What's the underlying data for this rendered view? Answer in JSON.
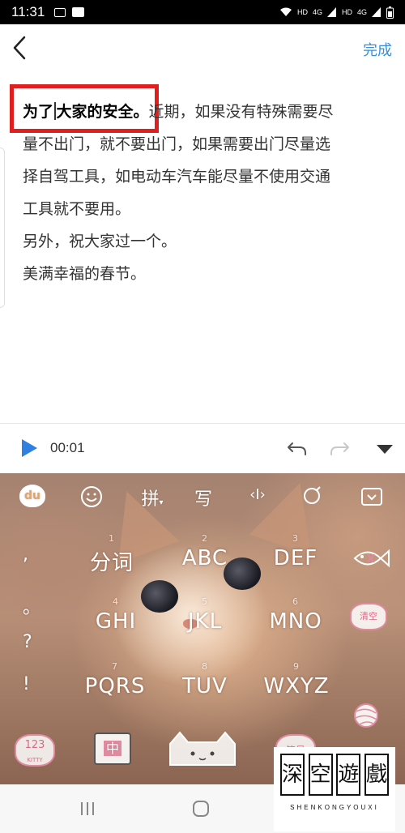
{
  "status_bar": {
    "time": "11:31",
    "network_label_1": "HD",
    "network_type_1": "4G",
    "network_label_2": "HD",
    "network_type_2": "4G"
  },
  "header": {
    "done_label": "完成"
  },
  "editor": {
    "highlighted_part_1": "为了",
    "highlighted_part_2": "大家的安全。",
    "line_1_rest": "近期，如果没有特殊需要尽",
    "line_2": "量不出门，就不要出门，如果需要出门尽量选",
    "line_3": "择自驾工具，如电动车汽车能尽量不使用交通",
    "line_4": "工具就不要用。",
    "line_5": "另外，祝大家过一个。",
    "line_6": "美满幸福的春节。"
  },
  "audio": {
    "time": "00:01"
  },
  "keyboard": {
    "toolbar": {
      "du_label": "du",
      "pinyin_label": "拼",
      "handwrite_label": "写",
      "cursor_label": "‹I›"
    },
    "keys": [
      {
        "name": "key-fenci",
        "label": "分词",
        "num": "1"
      },
      {
        "name": "key-abc",
        "label": "ABC",
        "num": "2"
      },
      {
        "name": "key-def",
        "label": "DEF",
        "num": "3"
      },
      {
        "name": "key-ghi",
        "label": "GHI",
        "num": "4"
      },
      {
        "name": "key-jkl",
        "label": "JKL",
        "num": "5"
      },
      {
        "name": "key-mno",
        "label": "MNO",
        "num": "6"
      },
      {
        "name": "key-pqrs",
        "label": "PQRS",
        "num": "7"
      },
      {
        "name": "key-tuv",
        "label": "TUV",
        "num": "8"
      },
      {
        "name": "key-wxyz",
        "label": "WXYZ",
        "num": "9"
      }
    ],
    "punctuation": [
      ",",
      "。",
      "?",
      "!"
    ],
    "clear_label": "清空",
    "num_key_label": "123",
    "num_key_sub": "KITTY",
    "lang_key_label": "中",
    "symbol_key_label": "符号"
  },
  "watermark": {
    "chars": [
      "深",
      "空",
      "遊",
      "戲"
    ],
    "subtitle": "SHENKONGYOUXI"
  }
}
